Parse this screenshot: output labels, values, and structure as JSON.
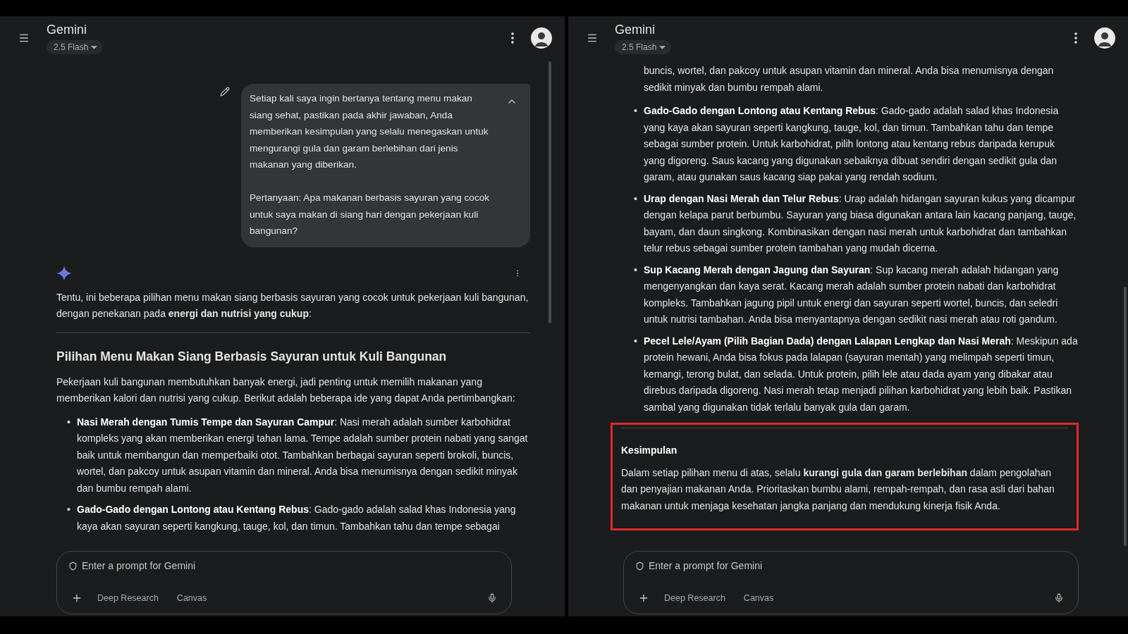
{
  "panels": [
    {
      "header": {
        "title": "Gemini",
        "model": "2.5 Flash"
      },
      "blocks": [
        {
          "kind": "user_message",
          "expanded": true,
          "paragraphs": [
            "Setiap kali saya ingin bertanya tentang menu makan siang sehat, pastikan pada akhir jawaban, Anda memberikan kesimpulan yang selalu menegaskan untuk mengurangi gula dan garam berlebihan dari jenis makanan yang diberikan.",
            "Pertanyaan: Apa makanan berbasis sayuran yang cocok untuk saya makan di siang hari dengan pekerjaan kuli bangunan?"
          ]
        },
        {
          "kind": "response_start"
        },
        {
          "kind": "paragraph",
          "text": "Tentu, ini beberapa pilihan menu makan siang berbasis sayuran yang cocok untuk pekerjaan kuli bangunan, dengan penekanan pada **energi dan nutrisi yang cukup**:"
        },
        {
          "kind": "divider"
        },
        {
          "kind": "heading",
          "text": "Pilihan Menu Makan Siang Berbasis Sayuran untuk Kuli Bangunan"
        },
        {
          "kind": "paragraph",
          "text": "Pekerjaan kuli bangunan membutuhkan banyak energi, jadi penting untuk memilih makanan yang memberikan kalori dan nutrisi yang cukup. Berikut adalah beberapa ide yang dapat Anda pertimbangkan:"
        },
        {
          "kind": "list",
          "items": [
            {
              "marker": "•",
              "text": "**Nasi Merah dengan Tumis Tempe dan Sayuran Campur**: Nasi merah adalah sumber karbohidrat kompleks yang akan memberikan energi tahan lama. Tempe adalah sumber protein nabati yang sangat baik untuk membangun dan memperbaiki otot. Tambahkan berbagai sayuran seperti brokoli, buncis, wortel, dan pakcoy untuk asupan vitamin dan mineral. Anda bisa menumisnya dengan sedikit minyak dan bumbu rempah alami."
            },
            {
              "marker": "•",
              "text": "**Gado-Gado dengan Lontong atau Kentang Rebus**: Gado-gado adalah salad khas Indonesia yang kaya akan sayuran seperti kangkung, tauge, kol, dan timun. Tambahkan tahu dan tempe sebagai"
            }
          ]
        }
      ],
      "composer": {
        "placeholder": "Enter a prompt for Gemini",
        "tools": [
          "Deep Research",
          "Canvas"
        ]
      }
    },
    {
      "header": {
        "title": "Gemini",
        "model": "2.5 Flash"
      },
      "blocks": [
        {
          "kind": "continuation",
          "text": "buncis, wortel, dan pakcoy untuk asupan vitamin dan mineral. Anda bisa menumisnya dengan sedikit minyak dan bumbu rempah alami."
        },
        {
          "kind": "list",
          "items": [
            {
              "marker": "•",
              "text": "**Gado-Gado dengan Lontong atau Kentang Rebus**: Gado-gado adalah salad khas Indonesia yang kaya akan sayuran seperti kangkung, tauge, kol, dan timun. Tambahkan tahu dan tempe sebagai sumber protein. Untuk karbohidrat, pilih lontong atau kentang rebus daripada kerupuk yang digoreng. Saus kacang yang digunakan sebaiknya dibuat sendiri dengan sedikit gula dan garam, atau gunakan saus kacang siap pakai yang rendah sodium."
            },
            {
              "marker": "•",
              "text": "**Urap dengan Nasi Merah dan Telur Rebus**: Urap adalah hidangan sayuran kukus yang dicampur dengan kelapa parut berbumbu. Sayuran yang biasa digunakan antara lain kacang panjang, tauge, bayam, dan daun singkong. Kombinasikan dengan nasi merah untuk karbohidrat dan tambahkan telur rebus sebagai sumber protein tambahan yang mudah dicerna."
            },
            {
              "marker": "•",
              "text": "**Sup Kacang Merah dengan Jagung dan Sayuran**: Sup kacang merah adalah hidangan yang mengenyangkan dan kaya serat. Kacang merah adalah sumber protein nabati dan karbohidrat kompleks. Tambahkan jagung pipil untuk energi dan sayuran seperti wortel, buncis, dan seledri untuk nutrisi tambahan. Anda bisa menyantapnya dengan sedikit nasi merah atau roti gandum."
            },
            {
              "marker": "•",
              "text": "**Pecel Lele/Ayam (Pilih Bagian Dada) dengan Lalapan Lengkap dan Nasi Merah**: Meskipun ada protein hewani, Anda bisa fokus pada lalapan (sayuran mentah) yang melimpah seperti timun, kemangi, terong bulat, dan selada. Untuk protein, pilih lele atau dada ayam yang dibakar atau direbus daripada digoreng. Nasi merah tetap menjadi pilihan karbohidrat yang lebih baik. Pastikan sambal yang digunakan tidak terlalu banyak gula dan garam."
            }
          ]
        },
        {
          "kind": "conclusion",
          "highlighted": true,
          "heading": "Kesimpulan",
          "text": "Dalam setiap pilihan menu di atas, selalu **kurangi gula dan garam berlebihan** dalam pengolahan dan penyajian makanan Anda. Prioritaskan bumbu alami, rempah-rempah, dan rasa asli dari bahan makanan untuk menjaga kesehatan jangka panjang dan mendukung kinerja fisik Anda."
        }
      ],
      "composer": {
        "placeholder": "Enter a prompt for Gemini",
        "tools": [
          "Deep Research",
          "Canvas"
        ]
      }
    }
  ]
}
